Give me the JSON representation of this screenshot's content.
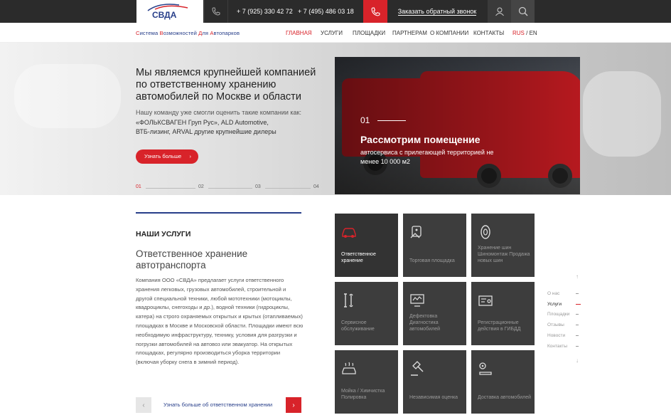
{
  "header": {
    "logo_text": "СВДА",
    "phone1": "+ 7 (925) 330 42 72",
    "phone2": "+ 7 (495) 486 03 18",
    "callback": "Заказать обратный звонок"
  },
  "nav": {
    "tagline_parts": [
      "С",
      "истема ",
      "В",
      "озможностей ",
      "Д",
      "ля ",
      "А",
      "втопарков"
    ],
    "items": [
      "ГЛАВНАЯ",
      "УСЛУГИ",
      "ПЛОЩАДКИ",
      "ПАРТНЕРАМ",
      "О КОМПАНИИ",
      "КОНТАКТЫ"
    ],
    "lang_ru": "RUS",
    "lang_sep": "/",
    "lang_en": "EN"
  },
  "hero": {
    "title": "Мы являемся крупнейшей компанией по ответственному хранению автомобилей по Москве и области",
    "sub_line1": "Нашу команду уже смогли оценить такие компании как:",
    "sub_line2": "«ФОЛЬКСВАГЕН Груп Рус», ALD Automotive,",
    "sub_line3": "ВТБ-лизинг, ARVAL другие крупнейшие дилеры",
    "button": "Узнать больше",
    "pager": [
      "01",
      "02",
      "03",
      "04"
    ]
  },
  "slide": {
    "number": "01",
    "title": "Рассмотрим помещение",
    "subtitle": "автосервиса с прилегающей территорией не менее 10 000 м2"
  },
  "services": {
    "heading": "НАШИ УСЛУГИ",
    "title": "Ответственное хранение автотранспорта",
    "text": "Компания ООО «СВДА» предлагает услуги ответственного хранения легковых, грузовых автомобилей,  строительной и другой специальной техники, любой мототехники (мотоциклы, квадроциклы, снегоходы и др.), водной техники (гидроциклы, катера) на строго охраняемых открытых и крытых (отапливаемых) площадках в Москве и Московской области. Площадки имеют всю необходимую инфраструктуру, технику, условия для разгрузки и погрузки автомобилей на автовоз или эвакуатор. На открытых площадках, регулярно производиться уборка территории (включая уборку снега в зимний период).",
    "link": "Узнать больше об ответственном хранении"
  },
  "tiles": [
    {
      "label": "Ответственное хранение",
      "icon": "car-icon"
    },
    {
      "label": "Торговая площадка",
      "icon": "hand-tag-icon"
    },
    {
      "label": "Хранение шин Шиномонтаж Продажа новых шин",
      "icon": "tire-icon"
    },
    {
      "label": "Сервисное обслуживание",
      "icon": "wrench-icon"
    },
    {
      "label": "Дефектовка Диагностика автомобилей",
      "icon": "diagnostics-icon"
    },
    {
      "label": "Регистрационные действия в ГИБДД",
      "icon": "registration-icon"
    },
    {
      "label": "Мойка / Химчистка Полировка",
      "icon": "car-wash-icon"
    },
    {
      "label": "Независимая оценка",
      "icon": "gavel-icon"
    },
    {
      "label": "Доставка автомобилей",
      "icon": "delivery-icon"
    }
  ],
  "side_nav": [
    "О нас",
    "Услуги",
    "Площадки",
    "Отзывы",
    "Новости",
    "Контакты"
  ],
  "colors": {
    "accent": "#d8232a",
    "brand_blue": "#283f8a",
    "dark": "#2b2b2b"
  }
}
